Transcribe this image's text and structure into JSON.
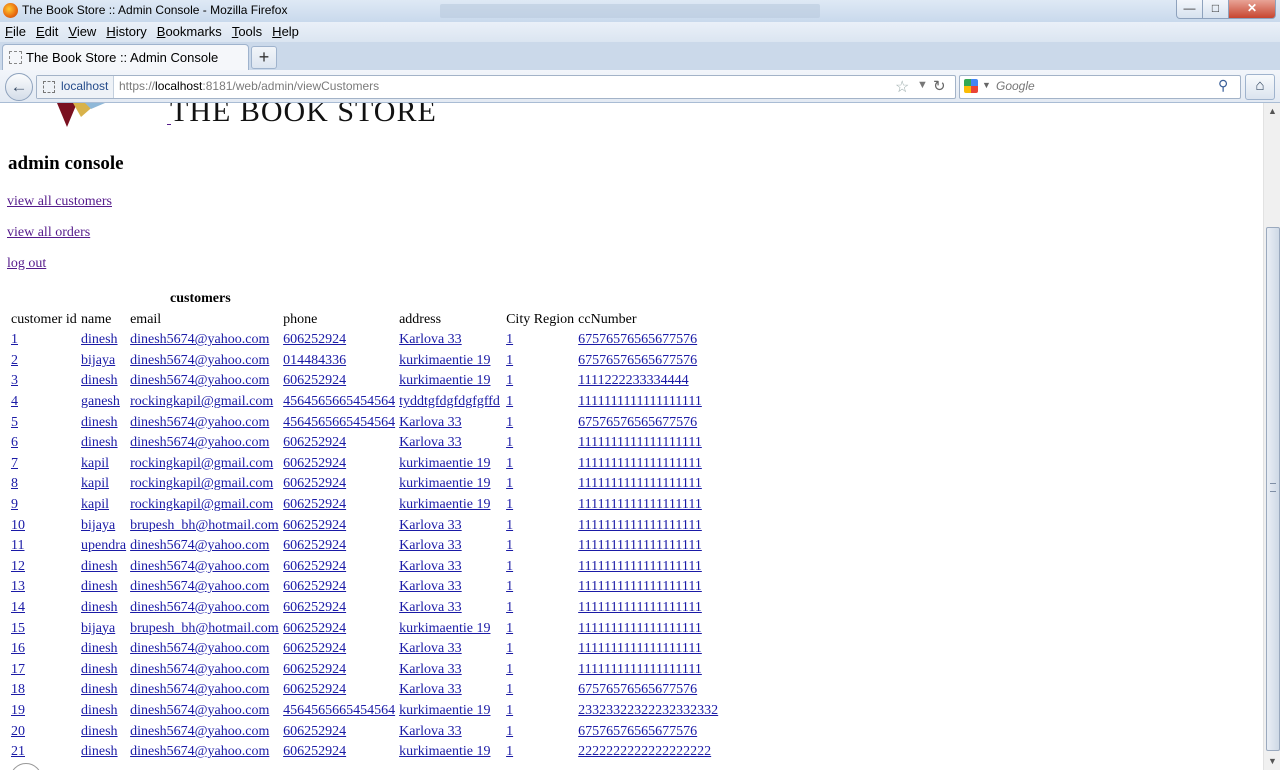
{
  "window": {
    "title": "The Book Store :: Admin Console - Mozilla Firefox",
    "minimize_label": "—",
    "maximize_label": "□",
    "close_label": "✕"
  },
  "menu": [
    {
      "label": "File",
      "key": "F",
      "rest": "ile"
    },
    {
      "label": "Edit",
      "key": "E",
      "rest": "dit"
    },
    {
      "label": "View",
      "key": "V",
      "rest": "iew"
    },
    {
      "label": "History",
      "key": "H",
      "rest": "istory"
    },
    {
      "label": "Bookmarks",
      "key": "B",
      "rest": "ookmarks"
    },
    {
      "label": "Tools",
      "key": "T",
      "rest": "ools"
    },
    {
      "label": "Help",
      "key": "H",
      "rest": "elp"
    }
  ],
  "tab": {
    "title": "The Book Store :: Admin Console",
    "new_tab_label": "+"
  },
  "navbar": {
    "back_icon": "←",
    "site_identity": "localhost",
    "url_prefix": "https://",
    "url_host": "localhost",
    "url_rest": ":8181/web/admin/viewCustomers",
    "bookmark_icon": "☆",
    "dropdown_icon": "▼",
    "reload_icon": "↻",
    "search_placeholder": "Google",
    "search_dropdown_icon": "▼",
    "search_icon": "⚲",
    "home_icon": "⌂"
  },
  "page": {
    "store_name": "THE BOOK STORE",
    "heading": "admin console",
    "links": {
      "customers": "view all customers",
      "orders": "view all orders",
      "logout": "log out"
    },
    "table_caption": "customers",
    "columns": [
      "customer id",
      "name",
      "email",
      "phone",
      "address",
      "City",
      "Region",
      "ccNumber"
    ],
    "rows": [
      {
        "id": "1",
        "name": "dinesh",
        "email": "dinesh5674@yahoo.com",
        "phone": "606252924",
        "address": "Karlova 33",
        "city": "1",
        "cc": "67576576565677576"
      },
      {
        "id": "2",
        "name": "bijaya",
        "email": "dinesh5674@yahoo.com",
        "phone": "014484336",
        "address": "kurkimaentie 19",
        "city": "1",
        "cc": "67576576565677576"
      },
      {
        "id": "3",
        "name": "dinesh",
        "email": "dinesh5674@yahoo.com",
        "phone": "606252924",
        "address": "kurkimaentie 19",
        "city": "1",
        "cc": "1111222233334444"
      },
      {
        "id": "4",
        "name": "ganesh",
        "email": "rockingkapil@gmail.com",
        "phone": "4564565665454564",
        "address": "tyddtgfdgfdgfgffd",
        "city": "1",
        "cc": "1111111111111111111"
      },
      {
        "id": "5",
        "name": "dinesh",
        "email": "dinesh5674@yahoo.com",
        "phone": "4564565665454564",
        "address": "Karlova 33",
        "city": "1",
        "cc": "67576576565677576"
      },
      {
        "id": "6",
        "name": "dinesh",
        "email": "dinesh5674@yahoo.com",
        "phone": "606252924",
        "address": "Karlova 33",
        "city": "1",
        "cc": "1111111111111111111"
      },
      {
        "id": "7",
        "name": "kapil",
        "email": "rockingkapil@gmail.com",
        "phone": "606252924",
        "address": "kurkimaentie 19",
        "city": "1",
        "cc": "1111111111111111111"
      },
      {
        "id": "8",
        "name": "kapil",
        "email": "rockingkapil@gmail.com",
        "phone": "606252924",
        "address": "kurkimaentie 19",
        "city": "1",
        "cc": "1111111111111111111"
      },
      {
        "id": "9",
        "name": "kapil",
        "email": "rockingkapil@gmail.com",
        "phone": "606252924",
        "address": "kurkimaentie 19",
        "city": "1",
        "cc": "1111111111111111111"
      },
      {
        "id": "10",
        "name": "bijaya",
        "email": "brupesh_bh@hotmail.com",
        "phone": "606252924",
        "address": "Karlova 33",
        "city": "1",
        "cc": "1111111111111111111"
      },
      {
        "id": "11",
        "name": "upendra",
        "email": "dinesh5674@yahoo.com",
        "phone": "606252924",
        "address": "Karlova 33",
        "city": "1",
        "cc": "1111111111111111111"
      },
      {
        "id": "12",
        "name": "dinesh",
        "email": "dinesh5674@yahoo.com",
        "phone": "606252924",
        "address": "Karlova 33",
        "city": "1",
        "cc": "1111111111111111111"
      },
      {
        "id": "13",
        "name": "dinesh",
        "email": "dinesh5674@yahoo.com",
        "phone": "606252924",
        "address": "Karlova 33",
        "city": "1",
        "cc": "1111111111111111111"
      },
      {
        "id": "14",
        "name": "dinesh",
        "email": "dinesh5674@yahoo.com",
        "phone": "606252924",
        "address": "Karlova 33",
        "city": "1",
        "cc": "1111111111111111111"
      },
      {
        "id": "15",
        "name": "bijaya",
        "email": "brupesh_bh@hotmail.com",
        "phone": "606252924",
        "address": "kurkimaentie 19",
        "city": "1",
        "cc": "1111111111111111111"
      },
      {
        "id": "16",
        "name": "dinesh",
        "email": "dinesh5674@yahoo.com",
        "phone": "606252924",
        "address": "Karlova 33",
        "city": "1",
        "cc": "1111111111111111111"
      },
      {
        "id": "17",
        "name": "dinesh",
        "email": "dinesh5674@yahoo.com",
        "phone": "606252924",
        "address": "Karlova 33",
        "city": "1",
        "cc": "1111111111111111111"
      },
      {
        "id": "18",
        "name": "dinesh",
        "email": "dinesh5674@yahoo.com",
        "phone": "606252924",
        "address": "Karlova 33",
        "city": "1",
        "cc": "67576576565677576"
      },
      {
        "id": "19",
        "name": "dinesh",
        "email": "dinesh5674@yahoo.com",
        "phone": "4564565665454564",
        "address": "kurkimaentie 19",
        "city": "1",
        "cc": "23323322322232332332"
      },
      {
        "id": "20",
        "name": "dinesh",
        "email": "dinesh5674@yahoo.com",
        "phone": "606252924",
        "address": "Karlova 33",
        "city": "1",
        "cc": "67576576565677576"
      },
      {
        "id": "21",
        "name": "dinesh",
        "email": "dinesh5674@yahoo.com",
        "phone": "606252924",
        "address": "kurkimaentie 19",
        "city": "1",
        "cc": "2222222222222222222"
      }
    ]
  },
  "scrollbar": {
    "up_icon": "▲",
    "down_icon": "▼"
  },
  "colors": {
    "link": "#1a1aa6",
    "visited_link": "#551a8b",
    "chrome": "#dbe5f1"
  }
}
